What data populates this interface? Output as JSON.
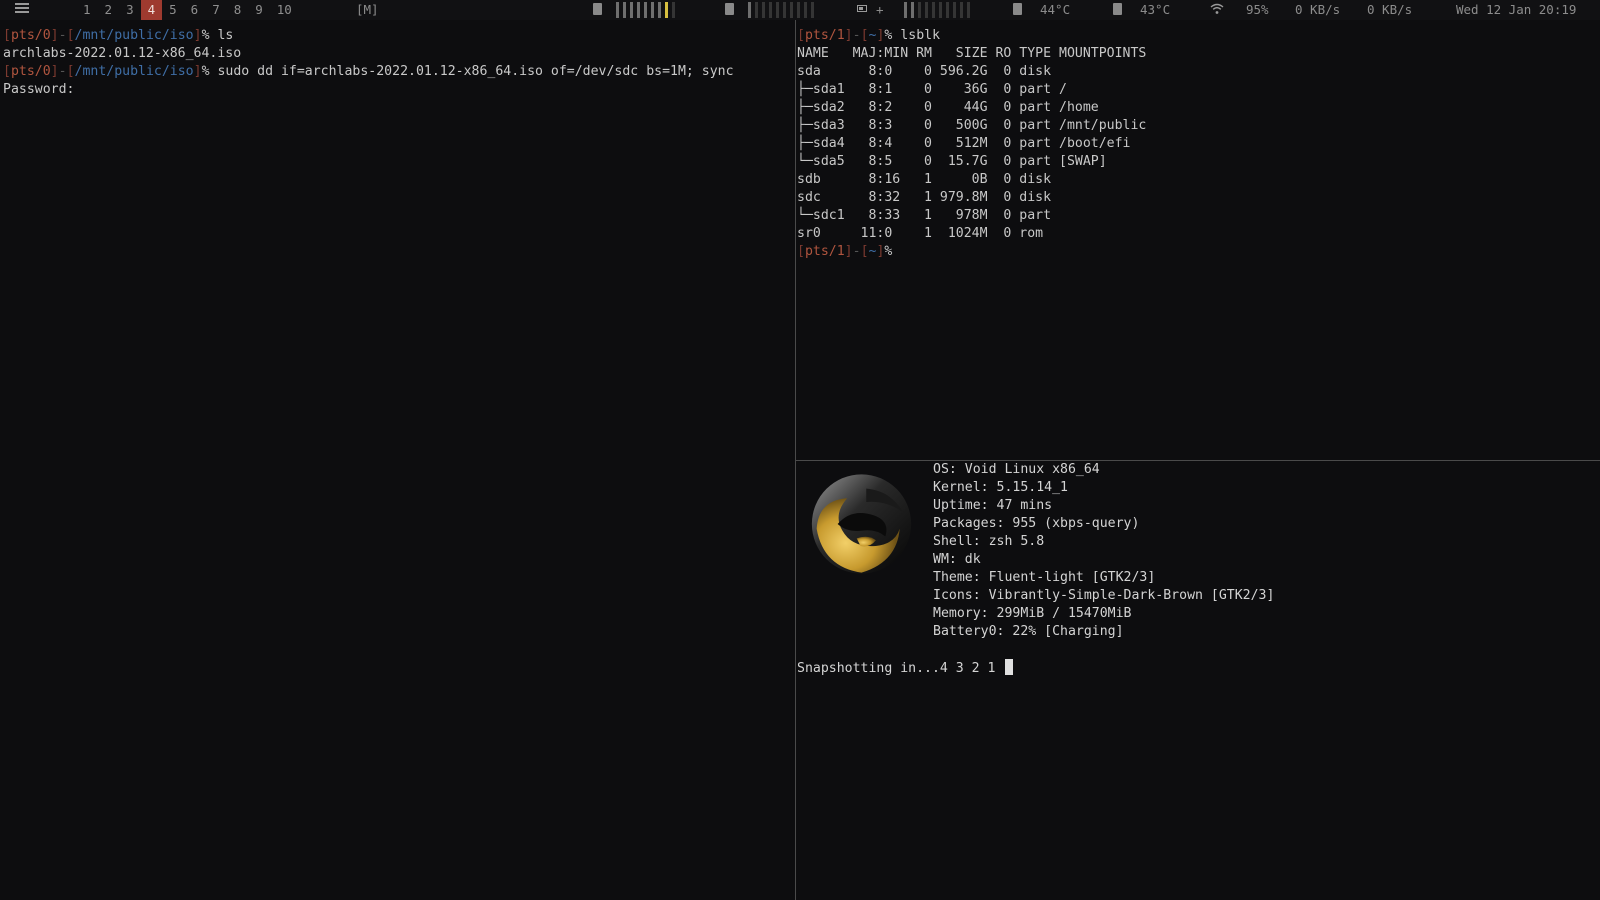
{
  "bar": {
    "menu_icon": "list-icon",
    "workspaces": [
      "1",
      "2",
      "3",
      "4",
      "5",
      "6",
      "7",
      "8",
      "9",
      "10"
    ],
    "active_workspace": "4",
    "layout": "[M]",
    "battery_plus": "+",
    "cpu_temp": "44°C",
    "gpu_temp": "43°C",
    "wifi": "95%",
    "net_down": "0 KB/s",
    "net_up": "0 KB/s",
    "datetime": "Wed 12 Jan 20:19",
    "accent_color": "#9e3a2f"
  },
  "left": {
    "tty": "pts/0",
    "path": "/mnt/public/iso",
    "cmd1": "ls",
    "out1": "archlabs-2022.01.12-x86_64.iso",
    "cmd2": "sudo dd if=archlabs-2022.01.12-x86_64.iso of=/dev/sdc bs=1M; sync",
    "out2": "Password:"
  },
  "top_right": {
    "tty": "pts/1",
    "path": "~",
    "cmd": "lsblk",
    "header": "NAME   MAJ:MIN RM   SIZE RO TYPE MOUNTPOINTS",
    "rows": [
      "sda      8:0    0 596.2G  0 disk",
      "├─sda1   8:1    0    36G  0 part /",
      "├─sda2   8:2    0    44G  0 part /home",
      "├─sda3   8:3    0   500G  0 part /mnt/public",
      "├─sda4   8:4    0   512M  0 part /boot/efi",
      "└─sda5   8:5    0  15.7G  0 part [SWAP]",
      "sdb      8:16   1     0B  0 disk",
      "sdc      8:32   1 979.8M  0 disk",
      "└─sdc1   8:33   1   978M  0 part",
      "sr0     11:0    1  1024M  0 rom"
    ]
  },
  "neofetch": {
    "logo_icon": "void-linux-logo-icon",
    "lines": [
      "OS: Void Linux x86_64",
      "Kernel: 5.15.14_1",
      "Uptime: 47 mins",
      "Packages: 955 (xbps-query)",
      "Shell: zsh 5.8",
      "WM: dk",
      "Theme: Fluent-light [GTK2/3]",
      "Icons: Vibrantly-Simple-Dark-Brown [GTK2/3]",
      "Memory: 299MiB / 15470MiB",
      "Battery0: 22% [Charging]"
    ],
    "snapshot": "Snapshotting in...4 3 2 1 "
  }
}
